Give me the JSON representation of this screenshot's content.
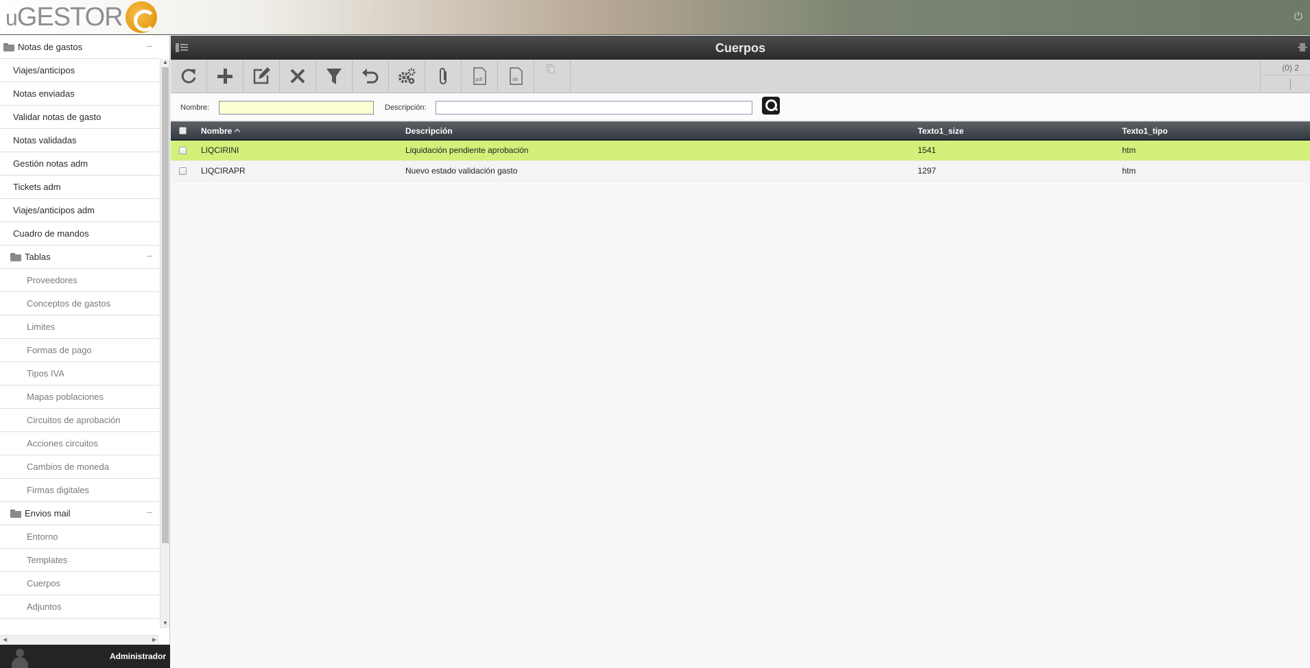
{
  "app": {
    "logo_text": "GESTOR",
    "logo_prefix": "u",
    "user": "Administrador"
  },
  "sidebar": {
    "group_main": "Notas de gastos",
    "items": [
      {
        "label": "Viajes/anticipos"
      },
      {
        "label": "Notas enviadas"
      },
      {
        "label": "Validar notas de gasto"
      },
      {
        "label": "Notas validadas"
      },
      {
        "label": "Gestión notas adm"
      },
      {
        "label": "Tickets adm"
      },
      {
        "label": "Viajes/anticipos adm"
      },
      {
        "label": "Cuadro de mandos"
      }
    ],
    "group_tablas": "Tablas",
    "tablas": [
      {
        "label": "Proveedores"
      },
      {
        "label": "Conceptos de gastos"
      },
      {
        "label": "Limites"
      },
      {
        "label": "Formas de pago"
      },
      {
        "label": "Tipos IVA"
      },
      {
        "label": "Mapas poblaciones"
      },
      {
        "label": "Circuitos de aprobación"
      },
      {
        "label": "Acciones circuitos"
      },
      {
        "label": "Cambios de moneda"
      },
      {
        "label": "Firmas digitales"
      }
    ],
    "group_envios": "Envios mail",
    "envios": [
      {
        "label": "Entorno"
      },
      {
        "label": "Templates"
      },
      {
        "label": "Cuerpos"
      },
      {
        "label": "Adjuntos"
      }
    ]
  },
  "main": {
    "title": "Cuerpos",
    "counter": "(0) 2",
    "toolbar": [
      {
        "name": "refresh-icon"
      },
      {
        "name": "add-icon"
      },
      {
        "name": "edit-icon"
      },
      {
        "name": "delete-icon"
      },
      {
        "name": "filter-icon"
      },
      {
        "name": "undo-icon"
      },
      {
        "name": "settings-icon"
      },
      {
        "name": "attach-icon"
      },
      {
        "name": "pdf-icon",
        "text": "pdf"
      },
      {
        "name": "xls-icon",
        "text": "xls"
      },
      {
        "name": "copy-icon"
      }
    ],
    "filters": {
      "nombre_label": "Nombre:",
      "nombre_value": "",
      "descripcion_label": "Descripción:",
      "descripcion_value": ""
    },
    "grid": {
      "columns": [
        "Nombre",
        "Descripción",
        "Texto1_size",
        "Texto1_tipo"
      ],
      "rows": [
        {
          "nombre": "LIQCIRINI",
          "descripcion": "Liquidación pendiente aprobación",
          "size": "1541",
          "tipo": "htm",
          "selected": true
        },
        {
          "nombre": "LIQCIRAPR",
          "descripcion": "Nuevo estado validación gasto",
          "size": "1297",
          "tipo": "htm",
          "selected": false
        }
      ],
      "selected_row_color": "#d2f07a"
    }
  }
}
